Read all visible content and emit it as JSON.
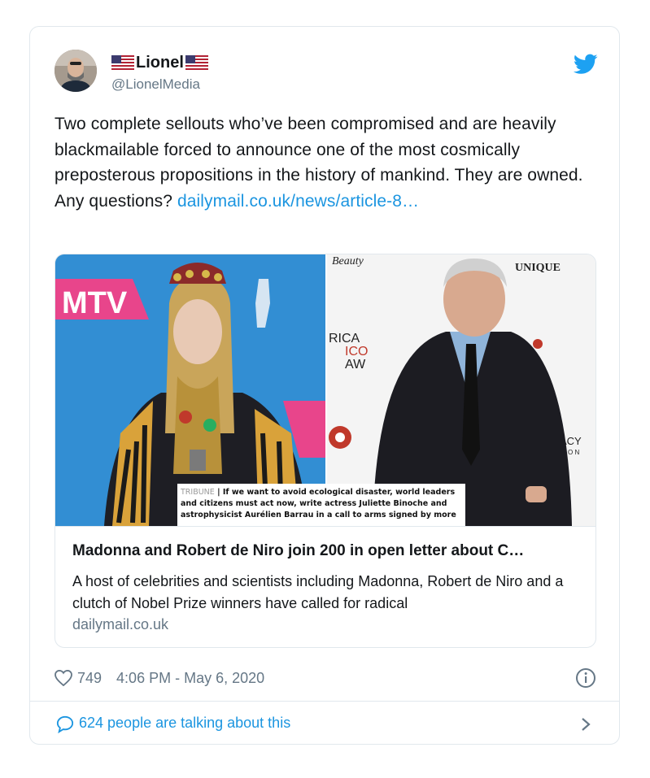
{
  "author": {
    "display_name": "Lionel",
    "handle": "@LionelMedia",
    "avatar_icon": "person-avatar"
  },
  "tweet": {
    "text": "Two complete sellouts who’ve been compromised and are heavily blackmailable forced to announce one of the most cosmically preposterous propositions in the history of mankind. They are owned. Any questions? ",
    "link_text": "dailymail.co.uk/news/article-8…"
  },
  "link_card": {
    "image_caption_tag": "TRIBUNE",
    "image_caption_text": "If we want to avoid ecological disaster, world leaders and citizens must act now, write actress Juliette Binoche and astrophysicist Aurélien Barrau in a call to arms signed by more",
    "title": "Madonna and Robert de Niro join 200 in open letter about C…",
    "description": "A host of celebrities and scientists including Madonna, Robert de Niro and a clutch of Nobel Prize winners have called for radical",
    "domain": "dailymail.co.uk",
    "backdrop_texts": {
      "mtv": "MTV",
      "unique": "UNIQUE",
      "rica": "RICA",
      "ico": "ICO",
      "aw": "AW",
      "acy": "ACY",
      "on": "O N"
    }
  },
  "meta": {
    "likes": "749",
    "timestamp": "4:06 PM - May 6, 2020"
  },
  "footer": {
    "talking": "624 people are talking about this"
  },
  "colors": {
    "link": "#1b95e0",
    "secondary": "#657786",
    "border": "#e1e8ed"
  }
}
